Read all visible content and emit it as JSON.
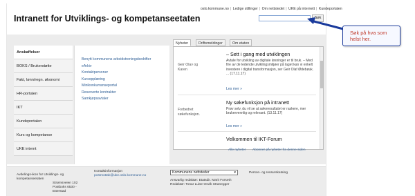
{
  "top_links": [
    "oslo.kommune.no",
    "Ledige stillinger",
    "Om nettstedet",
    "UKE på internett",
    "Kundeportalen"
  ],
  "site_title": "Intranett for Utviklings- og kompetanseetaten",
  "search": {
    "placeholder": "",
    "button_label": "Søk"
  },
  "sidebar": {
    "items": [
      {
        "label": "Anskaffelser",
        "active": true
      },
      {
        "label": "BOKS / Brukerstøtte"
      },
      {
        "label": "Fakt, lønn/regn. økonomi"
      },
      {
        "label": "HR-portalen"
      },
      {
        "label": "IKT"
      },
      {
        "label": "Kundeportalen"
      },
      {
        "label": "Kurs og kompetanse"
      },
      {
        "label": "UKE internt"
      }
    ]
  },
  "subnav": {
    "links": [
      "Benytt kommunens arbeidstreningsbedrifter",
      "eArkiv",
      "Kontaktpersoner",
      "Kursopplæring",
      "Minikonkurranseportal",
      "Reserverte kontrakter",
      "Samkjøpsavtaler"
    ]
  },
  "news": {
    "tabs": [
      "Nyheter",
      "Driftsmeldinger",
      "Om etaten"
    ],
    "items": [
      {
        "author": "Geir Olav og Karen",
        "title": "– Sett i gang med utviklingen",
        "text": "Avtale for utvikling av digitale løsninger er til bruk. – Med fire av de ledende utviklingsmiljøer på laget kan vi enkelt investere i digital transformasjon, ser Geir Olaf Ødebøuk. ... (17.11.17)",
        "more": "Les mer »"
      },
      {
        "author": "Forbedret søkefunksjon.",
        "title": "Ny søkefunksjon på intranett",
        "text": "Prøv selv, du vil se at søkeresultatet er raskere, mer brukervennlig og relevant. (13.11.17)",
        "more": "Les mer »"
      },
      {
        "author": "",
        "title": "Velkommen til IKT-Forum",
        "text": "",
        "more": ""
      }
    ],
    "footer_links": [
      "Alle nyheter",
      "Abonner på nyheter fra denne siden"
    ]
  },
  "footer": {
    "col1": [
      "Avdelings-ikon for Utviklings- og",
      "kompetanseetaten",
      "Strømsveien 102",
      "Postboks 6530 -",
      "Etterstad"
    ],
    "col2": [
      "Kontaktinformasjon",
      "postmottak@uke.oslo.kommune.no"
    ],
    "select_value": "Kommunens nettsteder",
    "editors": [
      "Ansvarlig redaktør: Etatsdir. Marit Forseth",
      "Redaktør: Tonar Luise Osvik Stranegger"
    ],
    "right_link": "Person- og ressurskatalog"
  },
  "annotation": {
    "text": "Søk på hva som helst her.",
    "border_color": "#1a3a9c",
    "text_color": "#c0392b"
  }
}
